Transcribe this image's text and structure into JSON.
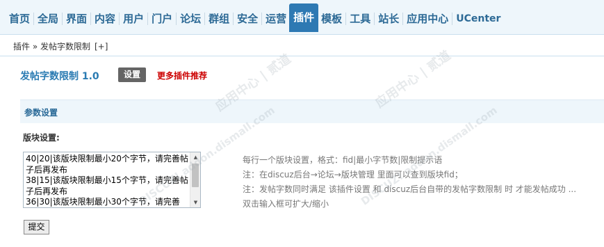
{
  "nav": {
    "items": [
      {
        "label": "首页"
      },
      {
        "label": "全局"
      },
      {
        "label": "界面"
      },
      {
        "label": "内容"
      },
      {
        "label": "用户"
      },
      {
        "label": "门户"
      },
      {
        "label": "论坛"
      },
      {
        "label": "群组"
      },
      {
        "label": "安全"
      },
      {
        "label": "运营"
      },
      {
        "label": "插件"
      },
      {
        "label": "模板"
      },
      {
        "label": "工具"
      },
      {
        "label": "站长"
      },
      {
        "label": "应用中心"
      },
      {
        "label": "UCenter"
      }
    ],
    "active_index": 10
  },
  "breadcrumb": {
    "path": "插件 » 发帖字数限制",
    "add": "[+]"
  },
  "plugin": {
    "title": "发帖字数限制 1.0",
    "settings_label": "设置",
    "more_label": "更多插件推荐"
  },
  "section": {
    "title": "参数设置"
  },
  "field": {
    "label": "版块设置:",
    "value": "40|20|该版块限制最小20个字节，请完善帖子后再发布\n38|15|该版块限制最小15个字节，请完善帖子后再发布\n36|30|该版块限制最小30个字节，请完善"
  },
  "tips": [
    "每行一个版块设置，格式：fid|最小字节数|限制提示语",
    "注：在discuz后台→论坛→版块管理 里面可以查到版块fid；",
    "注：发帖字数同时满足 该插件设置 和 discuz后台自带的发帖字数限制 时 才能发帖成功 ...",
    "双击输入框可扩大/缩小"
  ],
  "submit_label": "提交",
  "watermark": {
    "text_cn": "应用中心 | 贰道",
    "text_en": "DISCUZ! addon.dismall.com"
  }
}
